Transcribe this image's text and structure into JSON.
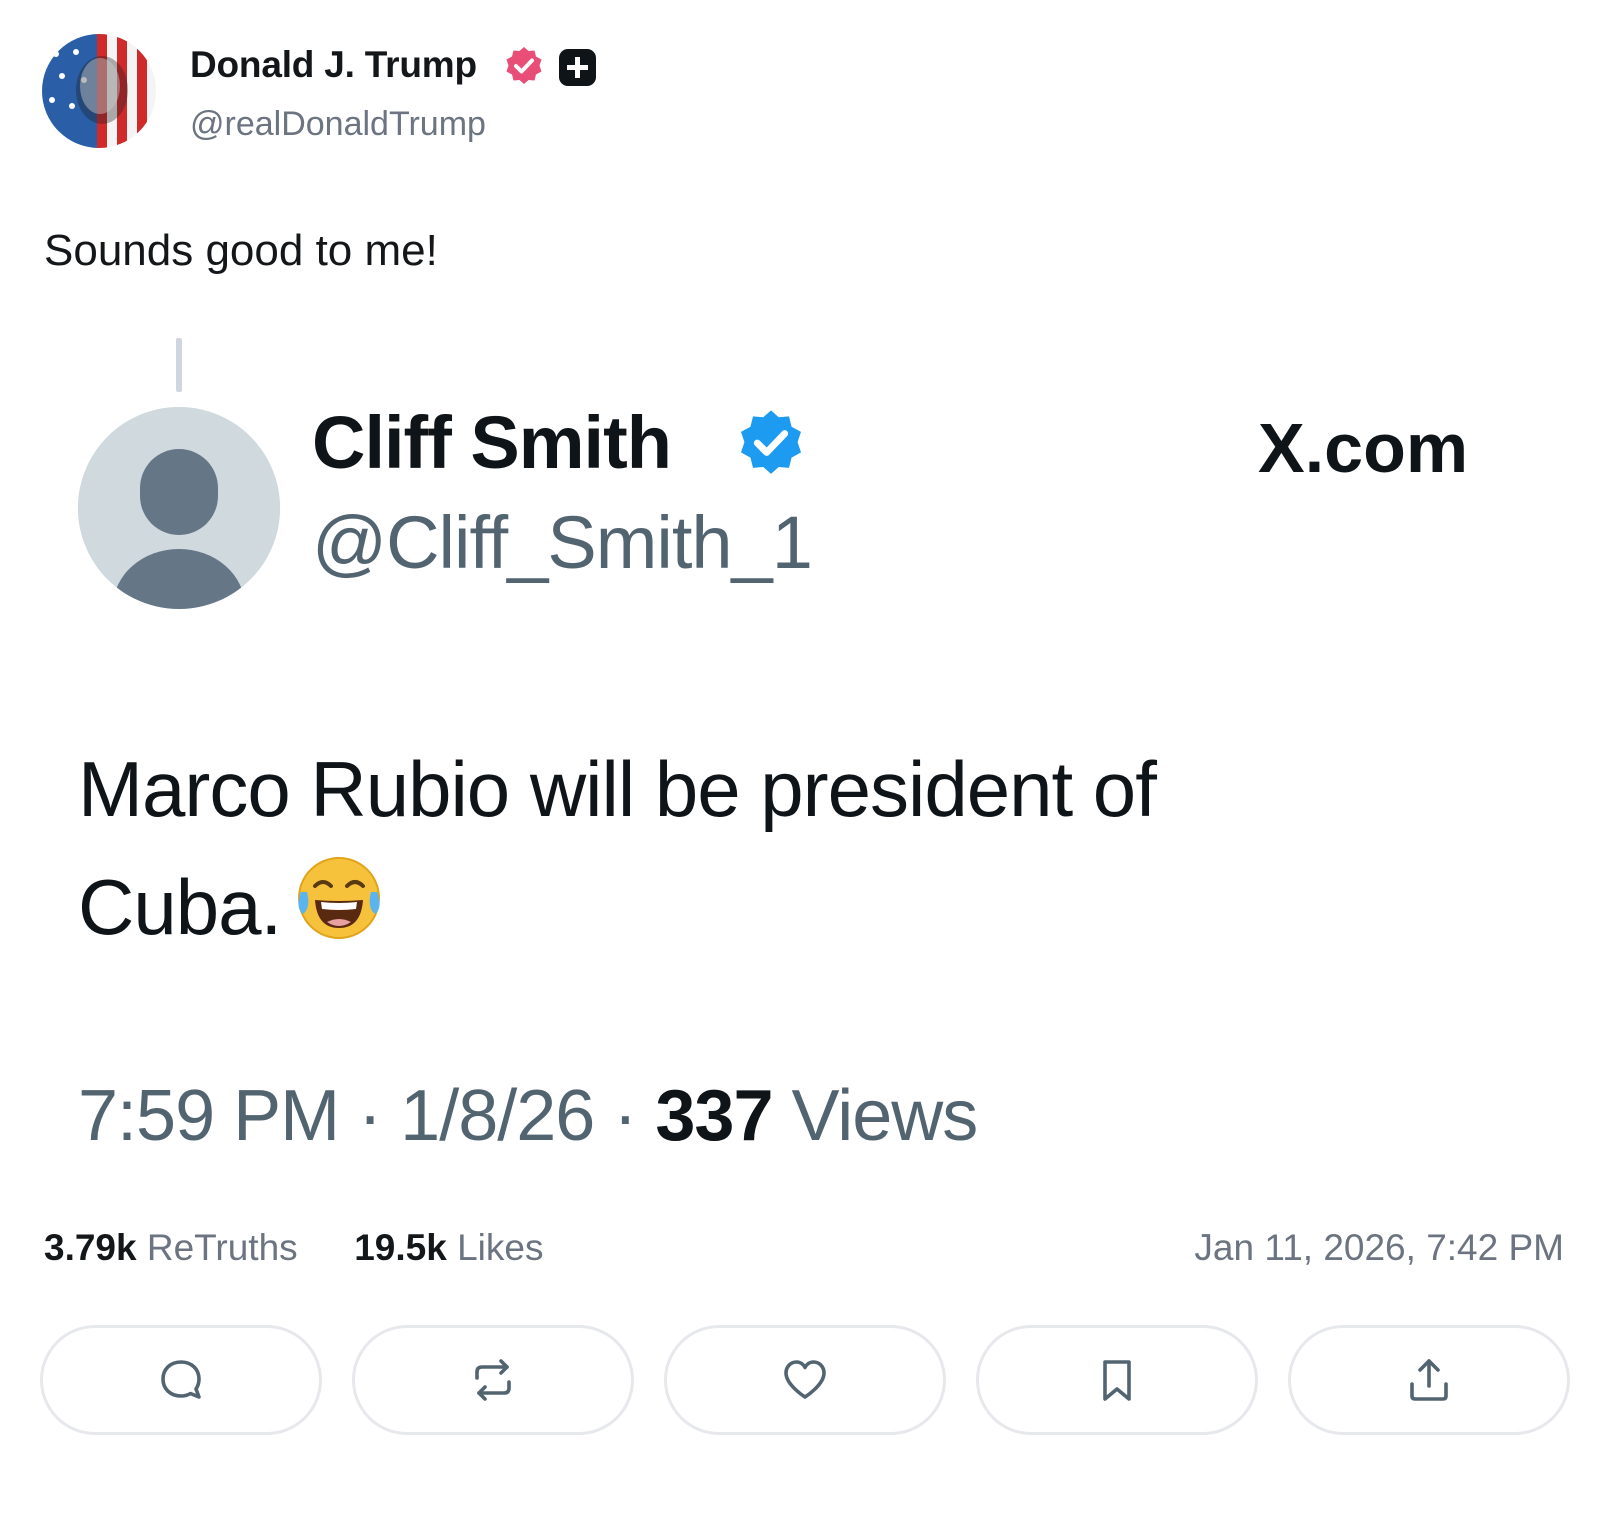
{
  "post": {
    "author_name": "Donald J. Trump",
    "author_handle": "@realDonaldTrump",
    "text": "Sounds good to me!",
    "icons": [
      "avatar",
      "verified-badge-icon",
      "plus-badge-icon"
    ]
  },
  "quoted": {
    "name": "Cliff Smith",
    "handle": "@Cliff_Smith_1",
    "source": "X.com",
    "text_line1": "Marco Rubio will be president of",
    "text_line2": "Cuba.",
    "emoji": "face-with-tears-of-joy",
    "time": "7:59 PM",
    "sep": "·",
    "date": "1/8/26",
    "views_count": "337",
    "views_label": "Views"
  },
  "stats": {
    "retruths_count": "3.79k",
    "retruths_label": "ReTruths",
    "likes_count": "19.5k",
    "likes_label": "Likes",
    "timestamp": "Jan 11, 2026, 7:42 PM"
  },
  "actions": [
    "reply-icon",
    "retruth-icon",
    "like-icon",
    "bookmark-icon",
    "share-icon"
  ],
  "colors": {
    "verified_pink": "#e94e77",
    "verified_blue": "#1d9bf0",
    "muted_text": "#536471"
  }
}
